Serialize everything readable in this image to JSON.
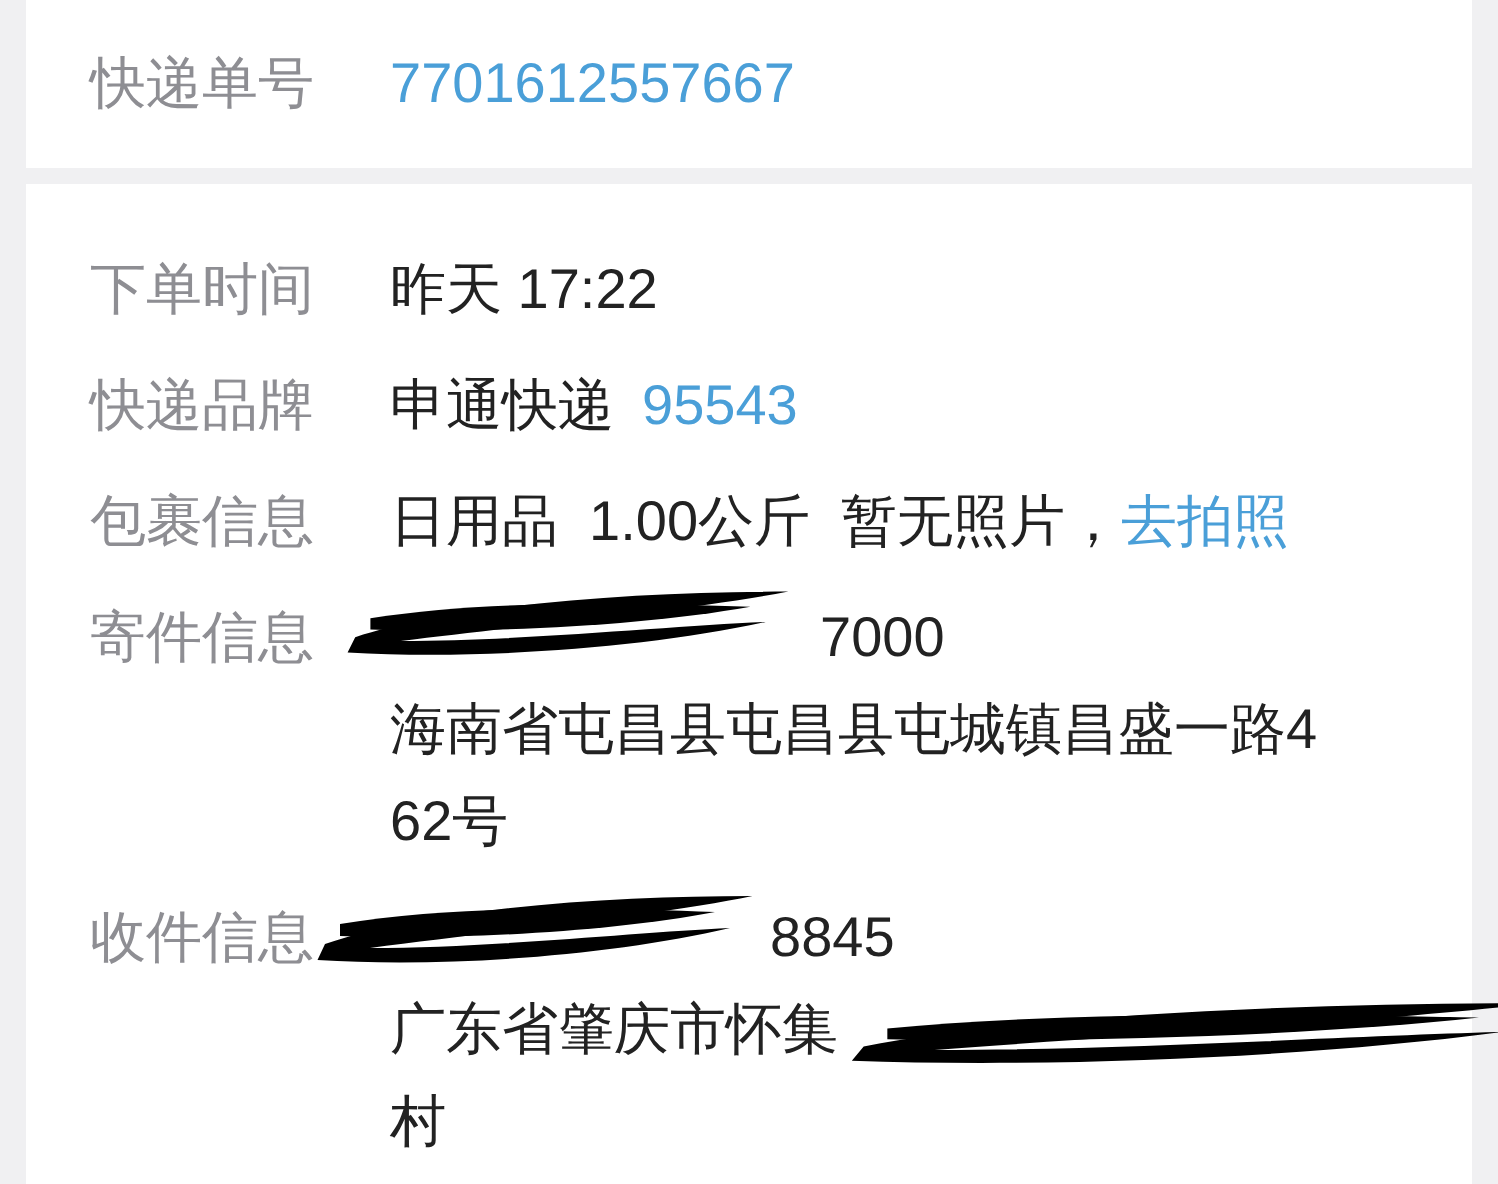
{
  "tracking": {
    "label": "快递单号",
    "number": "7701612557667"
  },
  "details": [
    {
      "kind": "text",
      "label": "下单时间",
      "lines": [
        "昨天 17:22"
      ]
    },
    {
      "kind": "brand",
      "label": "快递品牌",
      "lines": [
        "申通快递"
      ],
      "link": "95543"
    },
    {
      "kind": "package",
      "label": "包裹信息",
      "lines": [
        "日用品  1.00公斤  暂无照片，"
      ],
      "link": "去拍照"
    },
    {
      "kind": "sender",
      "label": "寄件信息",
      "lines": [
        "7000",
        "海南省屯昌县屯昌县屯城镇昌盛一路4",
        "62号"
      ]
    },
    {
      "kind": "receiver",
      "label": "收件信息",
      "lines": [
        "8845",
        "广东省肇庆市怀集",
        "村"
      ]
    }
  ]
}
